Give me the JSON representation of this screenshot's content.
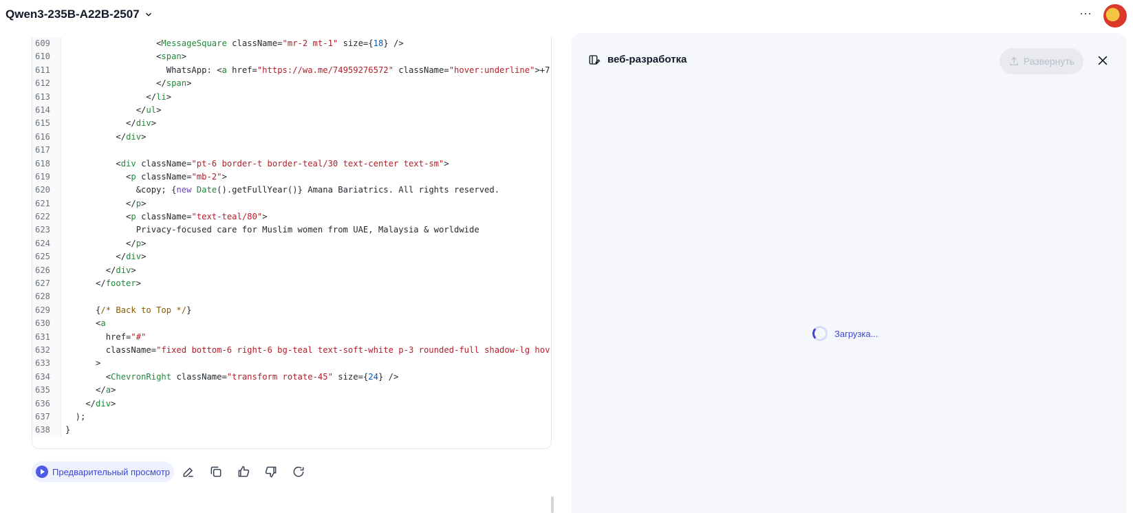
{
  "header": {
    "model_name": "Qwen3-235B-A22B-2507",
    "more_label": "···"
  },
  "code": {
    "lines": [
      {
        "n": "609",
        "tokens": [
          [
            "p",
            "                  <"
          ],
          [
            "tag",
            "MessageSquare"
          ],
          [
            "p",
            " className="
          ],
          [
            "str",
            "\"mr-2 mt-1\""
          ],
          [
            "p",
            " size={"
          ],
          [
            "num",
            "18"
          ],
          [
            "p",
            "} />"
          ]
        ]
      },
      {
        "n": "610",
        "tokens": [
          [
            "p",
            "                  <"
          ],
          [
            "tag",
            "span"
          ],
          [
            "p",
            ">"
          ]
        ]
      },
      {
        "n": "611",
        "tokens": [
          [
            "p",
            "                    WhatsApp: <"
          ],
          [
            "tag",
            "a"
          ],
          [
            "p",
            " href="
          ],
          [
            "str",
            "\"https://wa.me/74959276572\""
          ],
          [
            "p",
            " className="
          ],
          [
            "str",
            "\"hover:underline\""
          ],
          [
            "p",
            ">+7"
          ]
        ]
      },
      {
        "n": "612",
        "tokens": [
          [
            "p",
            "                  </"
          ],
          [
            "tag",
            "span"
          ],
          [
            "p",
            ">"
          ]
        ]
      },
      {
        "n": "613",
        "tokens": [
          [
            "p",
            "                </"
          ],
          [
            "tag",
            "li"
          ],
          [
            "p",
            ">"
          ]
        ]
      },
      {
        "n": "614",
        "tokens": [
          [
            "p",
            "              </"
          ],
          [
            "tag",
            "ul"
          ],
          [
            "p",
            ">"
          ]
        ]
      },
      {
        "n": "615",
        "tokens": [
          [
            "p",
            "            </"
          ],
          [
            "tag",
            "div"
          ],
          [
            "p",
            ">"
          ]
        ]
      },
      {
        "n": "616",
        "tokens": [
          [
            "p",
            "          </"
          ],
          [
            "tag",
            "div"
          ],
          [
            "p",
            ">"
          ]
        ]
      },
      {
        "n": "617",
        "tokens": [
          [
            "p",
            ""
          ]
        ]
      },
      {
        "n": "618",
        "tokens": [
          [
            "p",
            "          <"
          ],
          [
            "tag",
            "div"
          ],
          [
            "p",
            " className="
          ],
          [
            "str",
            "\"pt-6 border-t border-teal/30 text-center text-sm\""
          ],
          [
            "p",
            ">"
          ]
        ]
      },
      {
        "n": "619",
        "tokens": [
          [
            "p",
            "            <"
          ],
          [
            "tag",
            "p"
          ],
          [
            "p",
            " className="
          ],
          [
            "str",
            "\"mb-2\""
          ],
          [
            "p",
            ">"
          ]
        ]
      },
      {
        "n": "620",
        "tokens": [
          [
            "p",
            "              &copy; {"
          ],
          [
            "kw",
            "new"
          ],
          [
            "p",
            " "
          ],
          [
            "tag",
            "Date"
          ],
          [
            "p",
            "().getFullYear()} Amana Bariatrics. All rights reserved."
          ]
        ]
      },
      {
        "n": "621",
        "tokens": [
          [
            "p",
            "            </"
          ],
          [
            "tag",
            "p"
          ],
          [
            "p",
            ">"
          ]
        ]
      },
      {
        "n": "622",
        "tokens": [
          [
            "p",
            "            <"
          ],
          [
            "tag",
            "p"
          ],
          [
            "p",
            " className="
          ],
          [
            "str",
            "\"text-teal/80\""
          ],
          [
            "p",
            ">"
          ]
        ]
      },
      {
        "n": "623",
        "tokens": [
          [
            "p",
            "              Privacy-focused care for Muslim women from UAE, Malaysia & worldwide"
          ]
        ]
      },
      {
        "n": "624",
        "tokens": [
          [
            "p",
            "            </"
          ],
          [
            "tag",
            "p"
          ],
          [
            "p",
            ">"
          ]
        ]
      },
      {
        "n": "625",
        "tokens": [
          [
            "p",
            "          </"
          ],
          [
            "tag",
            "div"
          ],
          [
            "p",
            ">"
          ]
        ]
      },
      {
        "n": "626",
        "tokens": [
          [
            "p",
            "        </"
          ],
          [
            "tag",
            "div"
          ],
          [
            "p",
            ">"
          ]
        ]
      },
      {
        "n": "627",
        "tokens": [
          [
            "p",
            "      </"
          ],
          [
            "tag",
            "footer"
          ],
          [
            "p",
            ">"
          ]
        ]
      },
      {
        "n": "628",
        "tokens": [
          [
            "p",
            ""
          ]
        ]
      },
      {
        "n": "629",
        "tokens": [
          [
            "p",
            "      {"
          ],
          [
            "com",
            "/* Back to Top */"
          ],
          [
            "p",
            "}"
          ]
        ]
      },
      {
        "n": "630",
        "tokens": [
          [
            "p",
            "      <"
          ],
          [
            "tag",
            "a"
          ]
        ]
      },
      {
        "n": "631",
        "tokens": [
          [
            "p",
            "        href="
          ],
          [
            "str",
            "\"#\""
          ]
        ]
      },
      {
        "n": "632",
        "tokens": [
          [
            "p",
            "        className="
          ],
          [
            "str",
            "\"fixed bottom-6 right-6 bg-teal text-soft-white p-3 rounded-full shadow-lg hov"
          ]
        ]
      },
      {
        "n": "633",
        "tokens": [
          [
            "p",
            "      >"
          ]
        ]
      },
      {
        "n": "634",
        "tokens": [
          [
            "p",
            "        <"
          ],
          [
            "tag",
            "ChevronRight"
          ],
          [
            "p",
            " className="
          ],
          [
            "str",
            "\"transform rotate-45\""
          ],
          [
            "p",
            " size={"
          ],
          [
            "num",
            "24"
          ],
          [
            "p",
            "} />"
          ]
        ]
      },
      {
        "n": "635",
        "tokens": [
          [
            "p",
            "      </"
          ],
          [
            "tag",
            "a"
          ],
          [
            "p",
            ">"
          ]
        ]
      },
      {
        "n": "636",
        "tokens": [
          [
            "p",
            "    </"
          ],
          [
            "tag",
            "div"
          ],
          [
            "p",
            ">"
          ]
        ]
      },
      {
        "n": "637",
        "tokens": [
          [
            "p",
            "  );"
          ]
        ]
      },
      {
        "n": "638",
        "tokens": [
          [
            "p",
            "}"
          ]
        ]
      }
    ]
  },
  "actions": {
    "preview_label": "Предварительный просмотр",
    "icons": [
      "edit-icon",
      "copy-icon",
      "thumbs-up-icon",
      "thumbs-down-icon",
      "regenerate-icon"
    ]
  },
  "panel": {
    "title": "веб-разработка",
    "deploy_label": "Развернуть",
    "loading_text": "Загрузка..."
  },
  "colors": {
    "accent": "#3b46d6",
    "panel_bg": "#f6f7fb"
  }
}
